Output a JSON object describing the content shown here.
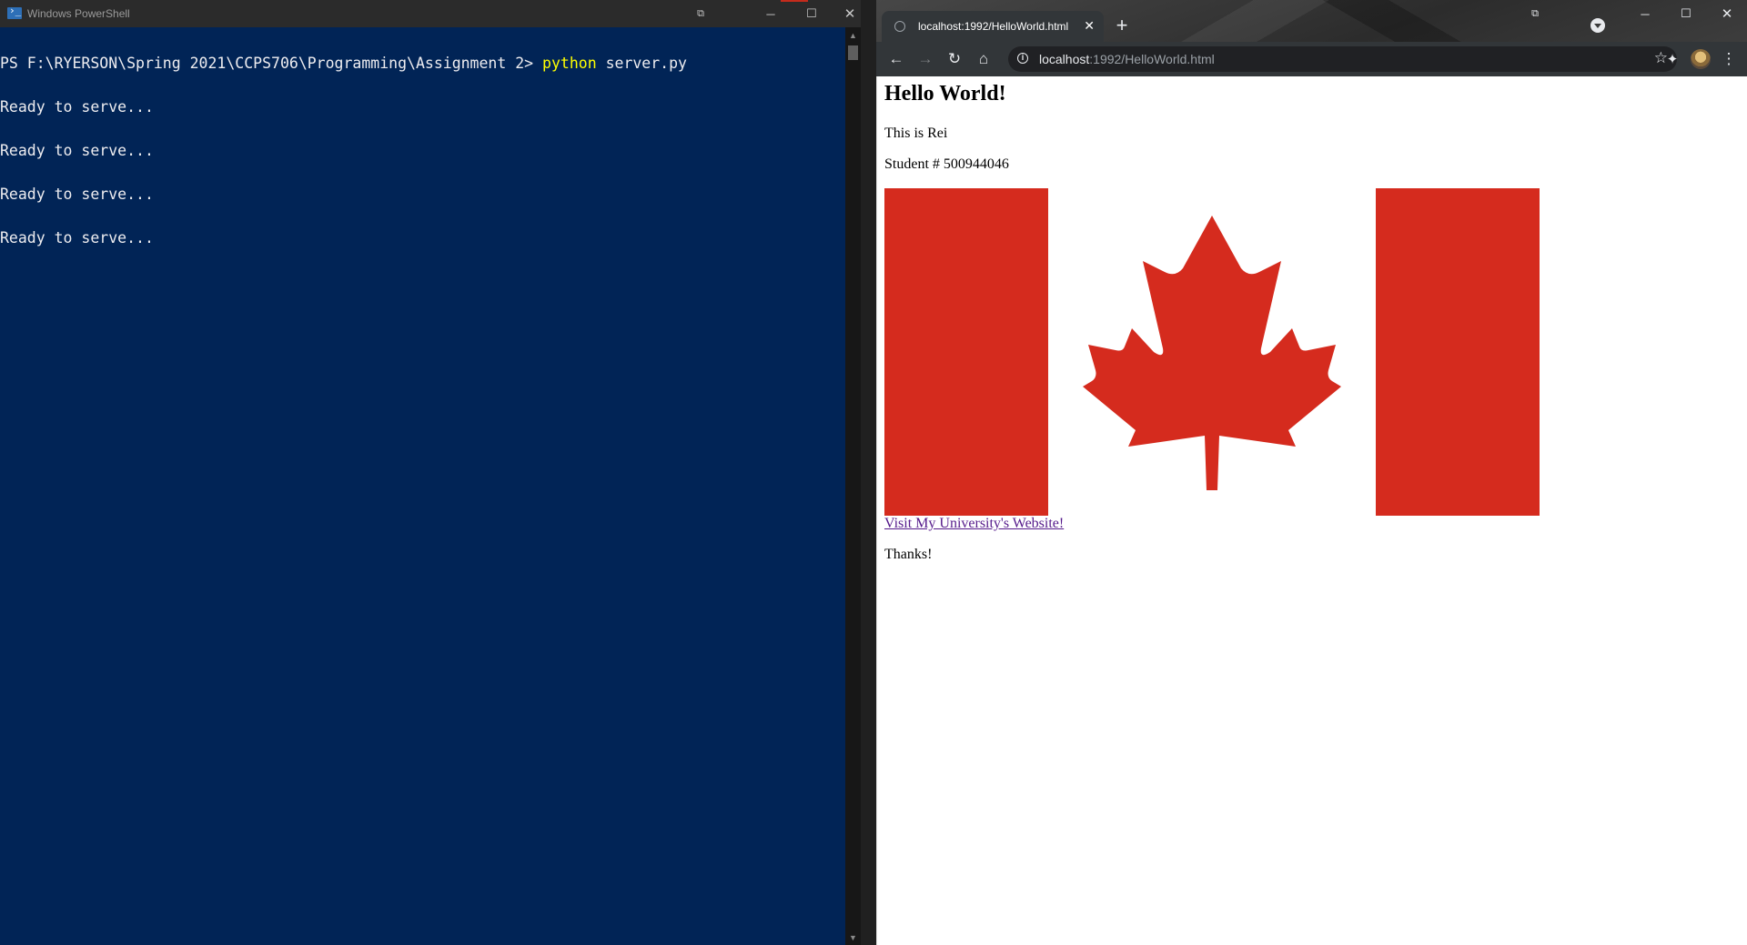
{
  "powershell": {
    "title": "Windows PowerShell",
    "prompt": "PS F:\\RYERSON\\Spring 2021\\CCPS706\\Programming\\Assignment 2> ",
    "command": "python",
    "args": " server.py",
    "output": [
      "Ready to serve...",
      "Ready to serve...",
      "Ready to serve...",
      "Ready to serve..."
    ],
    "icons": {
      "minimize": "minimize-icon",
      "maximize": "maximize-icon",
      "close": "close-icon"
    }
  },
  "browser": {
    "tab_title": "localhost:1992/HelloWorld.html",
    "url_host": "localhost",
    "url_path": ":1992/HelloWorld.html",
    "page": {
      "heading": "Hello World!",
      "intro": "This is Rei",
      "student": "Student # 500944046",
      "link": "Visit My University's Website!",
      "closing": "Thanks!"
    },
    "flag_colors": {
      "red": "#d52b1e",
      "white": "#ffffff"
    }
  },
  "colors": {
    "ps_background": "#012456",
    "ps_text": "#eeedf0",
    "ps_command": "#ffff00",
    "link_visited": "#551a8b"
  }
}
